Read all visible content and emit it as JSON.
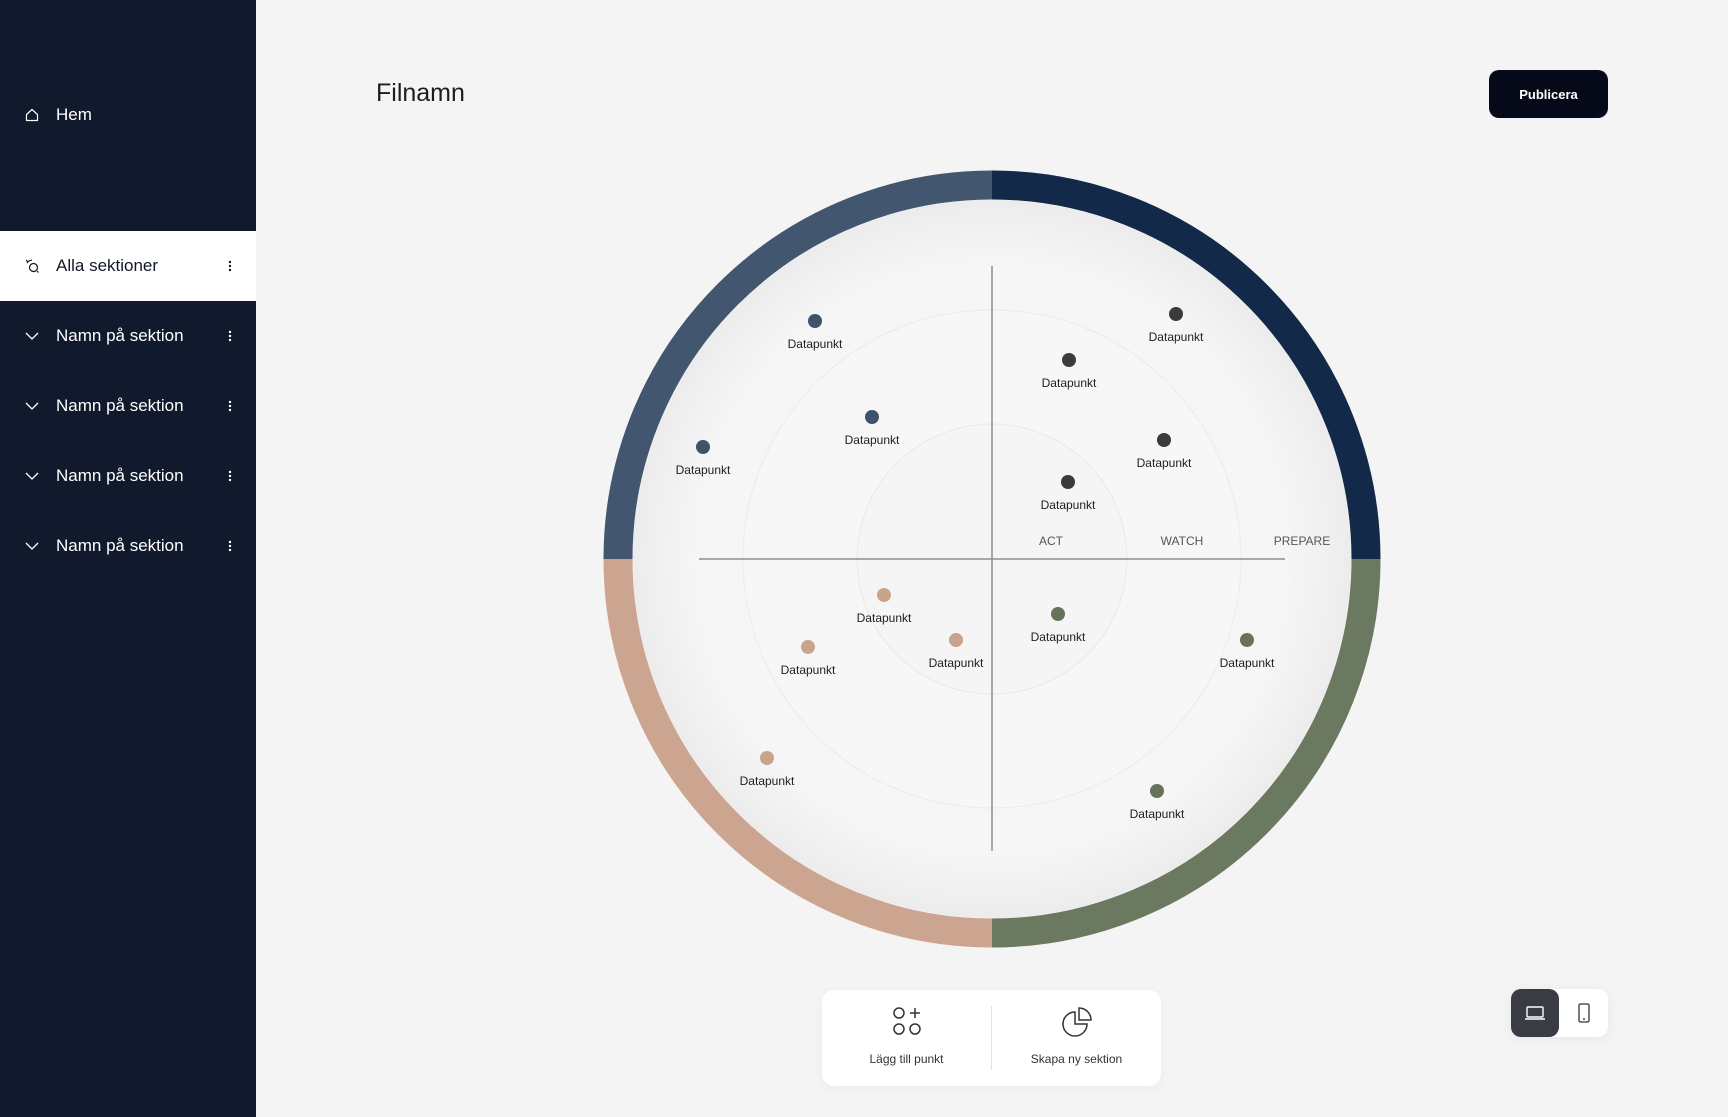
{
  "sidebar": {
    "items": [
      {
        "label": "Hem",
        "icon": "home-icon"
      },
      {
        "label": "Alla sektioner",
        "icon": "sections-icon",
        "active": true
      },
      {
        "label": "Namn på sektion",
        "icon": "chevron-down-icon"
      },
      {
        "label": "Namn på sektion",
        "icon": "chevron-down-icon"
      },
      {
        "label": "Namn på sektion",
        "icon": "chevron-down-icon"
      },
      {
        "label": "Namn på sektion",
        "icon": "chevron-down-icon"
      }
    ]
  },
  "header": {
    "title": "Filnamn",
    "publish_label": "Publicera"
  },
  "radar": {
    "rings": [
      "ACT",
      "WATCH",
      "PREPARE"
    ],
    "quadrant_colors": {
      "top_left": "#425670",
      "top_right": "#13294a",
      "bottom_right": "#6b7960",
      "bottom_left": "#cba590"
    },
    "points": [
      {
        "label": "Datapunkt",
        "quadrant": "top_left",
        "color": "#3f536d"
      },
      {
        "label": "Datapunkt",
        "quadrant": "top_left",
        "color": "#3f536d"
      },
      {
        "label": "Datapunkt",
        "quadrant": "top_left",
        "color": "#3f536d"
      },
      {
        "label": "Datapunkt",
        "quadrant": "top_right",
        "color": "#3b3b3b"
      },
      {
        "label": "Datapunkt",
        "quadrant": "top_right",
        "color": "#3b3b3b"
      },
      {
        "label": "Datapunkt",
        "quadrant": "top_right",
        "color": "#3b3b3b"
      },
      {
        "label": "Datapunkt",
        "quadrant": "top_right",
        "color": "#3b3b3b"
      },
      {
        "label": "Datapunkt",
        "quadrant": "bottom_left",
        "color": "#c9a48c"
      },
      {
        "label": "Datapunkt",
        "quadrant": "bottom_left",
        "color": "#c9a48c"
      },
      {
        "label": "Datapunkt",
        "quadrant": "bottom_left",
        "color": "#c9a48c"
      },
      {
        "label": "Datapunkt",
        "quadrant": "bottom_left",
        "color": "#c9a48c"
      },
      {
        "label": "Datapunkt",
        "quadrant": "bottom_right",
        "color": "#66735a"
      },
      {
        "label": "Datapunkt",
        "quadrant": "bottom_right",
        "color": "#66735a"
      },
      {
        "label": "Datapunkt",
        "quadrant": "bottom_right",
        "color": "#66735a"
      }
    ]
  },
  "toolbar": {
    "add_point_label": "Lägg till punkt",
    "new_section_label": "Skapa ny sektion"
  },
  "device_toggle": {
    "selected": "desktop",
    "options": [
      "desktop",
      "mobile"
    ]
  }
}
